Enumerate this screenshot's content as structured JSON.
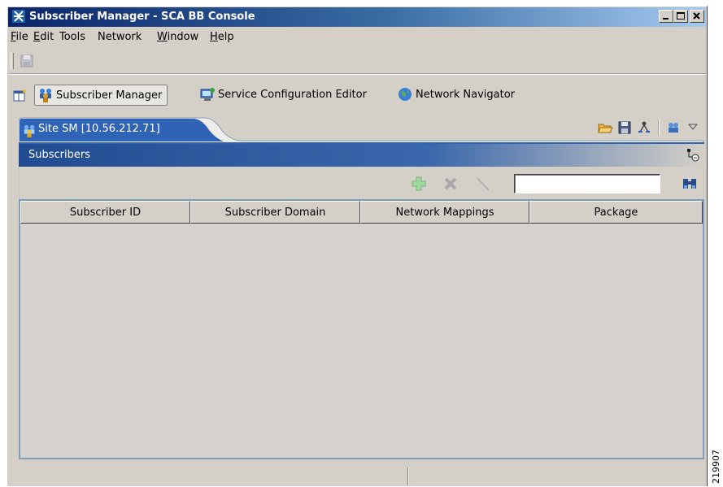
{
  "window": {
    "title": "Subscriber Manager - SCA BB Console",
    "controls": [
      "minimize",
      "maximize",
      "close"
    ]
  },
  "menu": [
    {
      "label": "File",
      "mnemonic": "F",
      "rest": "ile"
    },
    {
      "label": "Edit",
      "mnemonic": "E",
      "rest": "dit"
    },
    {
      "label": "Tools",
      "mnemonic": "",
      "rest": "Tools"
    },
    {
      "label": "Network",
      "mnemonic": "",
      "rest": "Network"
    },
    {
      "label": "Window",
      "mnemonic": "W",
      "rest": "indow"
    },
    {
      "label": "Help",
      "mnemonic": "H",
      "rest": "elp"
    }
  ],
  "perspectives": [
    {
      "label": "Subscriber Manager",
      "icon": "subscriber-manager-icon",
      "active": true
    },
    {
      "label": "Service Configuration Editor",
      "icon": "service-config-icon",
      "active": false
    },
    {
      "label": "Network Navigator",
      "icon": "globe-icon",
      "active": false
    }
  ],
  "view": {
    "tab_label": "Site SM [10.56.212.71]",
    "panel_title": "Subscribers",
    "search": {
      "value": "",
      "placeholder": ""
    },
    "columns": [
      "Subscriber ID",
      "Subscriber Domain",
      "Network Mappings",
      "Package"
    ],
    "rows": []
  },
  "side_label": "219907",
  "colors": {
    "titlebar_start": "#0a246a",
    "titlebar_end": "#a6caf0",
    "panel_header": "#214c91",
    "window_bg": "#d4d0c8",
    "table_border": "#7f9db9"
  }
}
